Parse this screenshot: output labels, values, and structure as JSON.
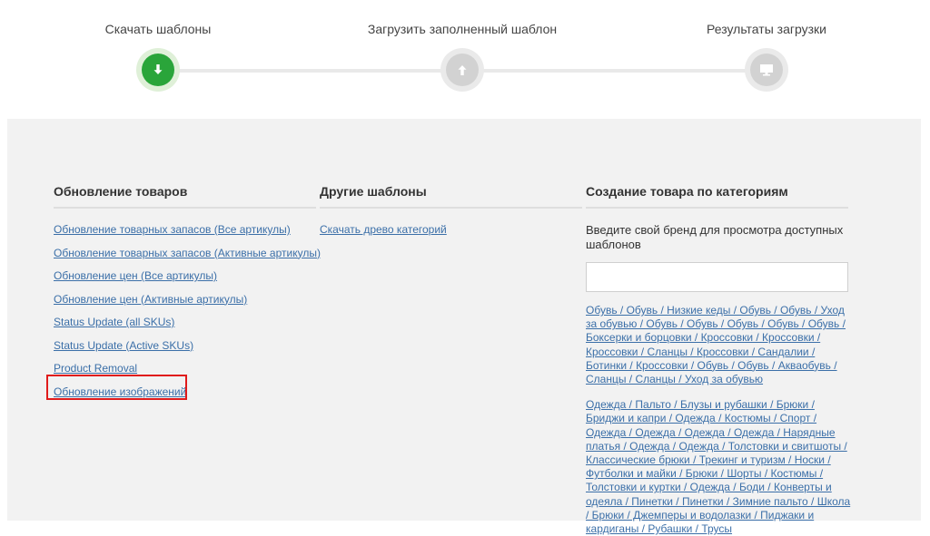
{
  "stepper": {
    "steps": [
      {
        "label": "Скачать шаблоны",
        "icon": "download-arrow-icon",
        "state": "active"
      },
      {
        "label": "Загрузить заполненный шаблон",
        "icon": "upload-arrow-icon",
        "state": "inactive"
      },
      {
        "label": "Результаты загрузки",
        "icon": "monitor-icon",
        "state": "inactive"
      }
    ],
    "colors": {
      "active": "#2aa53a",
      "inactive": "#d2d2d2"
    }
  },
  "update_products": {
    "title": "Обновление товаров",
    "links": [
      "Обновление товарных запасов (Все артикулы)",
      "Обновление товарных запасов (Активные артикулы)",
      "Обновление цен (Все артикулы)",
      "Обновление цен (Активные артикулы)",
      "Status Update (all SKUs)",
      "Status Update (Active SKUs)",
      "Product Removal",
      "Обновление изображений"
    ],
    "highlighted_link": "Обновление изображений"
  },
  "other_templates": {
    "title": "Другие шаблоны",
    "links": [
      "Скачать древо категорий"
    ]
  },
  "create_by_category": {
    "title": "Создание товара по категориям",
    "prompt": "Введите свой бренд для просмотра доступных шаблонов",
    "input_value": "",
    "category_groups": [
      "Обувь / Обувь / Низкие кеды / Обувь / Обувь / Уход за обувью / Обувь / Обувь / Обувь / Обувь / Обувь / Боксерки и борцовки / Кроссовки / Кроссовки / Кроссовки / Сланцы / Кроссовки / Сандалии / Ботинки / Кроссовки / Обувь / Обувь / Аквaобувь / Сланцы / Сланцы / Уход за обувью",
      "Одежда / Пальто / Блузы и рубашки / Брюки / Бриджи и капри / Одежда / Костюмы / Спорт / Одежда / Одежда / Одежда / Одежда / Нарядные платья / Одежда / Одежда / Толстовки и свитшоты / Классические брюки / Трекинг и туризм / Носки / Футболки и майки / Брюки / Шорты / Костюмы / Толстовки и куртки / Одежда / Боди / Конверты и одеяла / Пинетки / Пинетки / Зимние пальто / Школа / Брюки / Джемперы и водолазки / Пиджаки и кардиганы / Рубашки / Трусы"
    ]
  }
}
